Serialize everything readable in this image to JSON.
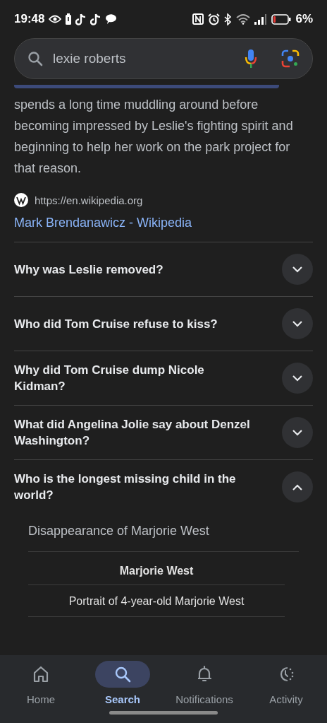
{
  "status_bar": {
    "time": "19:48",
    "battery": "6%"
  },
  "search": {
    "value": "lexie roberts"
  },
  "snippet": {
    "text": "spends a long time muddling around before becoming impressed by Leslie's fighting spirit and beginning to help her work on the park project for that reason.",
    "source_url": "https://en.wikipedia.org",
    "link": "Mark Brendanawicz - Wikipedia"
  },
  "questions": [
    {
      "text": "Why was Leslie removed?",
      "expanded": false
    },
    {
      "text": "Who did Tom Cruise refuse to kiss?",
      "expanded": false
    },
    {
      "text": "Why did Tom Cruise dump Nicole Kidman?",
      "expanded": false
    },
    {
      "text": "What did Angelina Jolie say about Denzel Washington?",
      "expanded": false
    },
    {
      "text": "Who is the longest missing child in the world?",
      "expanded": true,
      "answer": {
        "title": "Disappearance of Marjorie West",
        "infobox_title": "Marjorie West",
        "caption": "Portrait of 4-year-old Marjorie West"
      }
    }
  ],
  "nav": [
    {
      "label": "Home",
      "kind": "home",
      "selected": false
    },
    {
      "label": "Search",
      "kind": "search",
      "selected": true
    },
    {
      "label": "Notifications",
      "kind": "bell",
      "selected": false
    },
    {
      "label": "Activity",
      "kind": "activity",
      "selected": false
    }
  ]
}
